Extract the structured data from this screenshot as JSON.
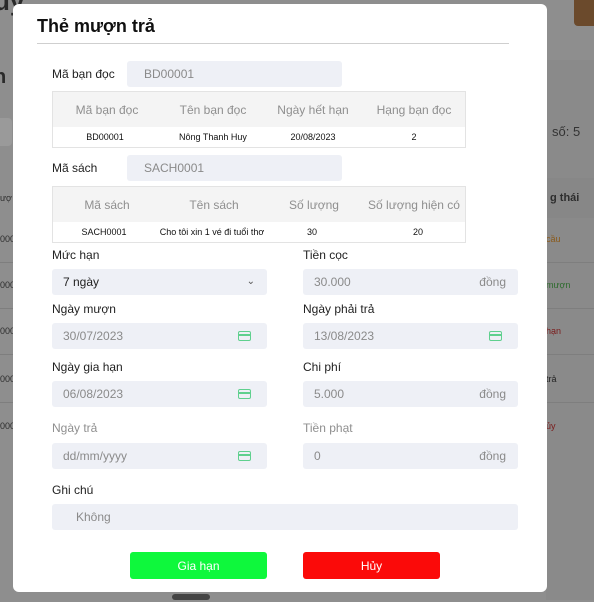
{
  "background": {
    "title_fragment": "uy",
    "letter_fragment": "n",
    "count_text": "số: 5",
    "status_header": "g thái",
    "statuses": [
      {
        "text": "cầu",
        "color": "#8a5a1a"
      },
      {
        "text": "mượn",
        "color": "#2e6b2e"
      },
      {
        "text": "hạn",
        "color": "#7a1a1a"
      },
      {
        "text": "trả",
        "color": "#222222"
      },
      {
        "text": "ủy",
        "color": "#7a1a1a"
      }
    ],
    "left_cells": [
      "000",
      "000",
      "000",
      "000",
      "000"
    ],
    "left_header": "ượ"
  },
  "modal": {
    "title": "Thẻ mượn trả",
    "reader": {
      "label": "Mã bạn đọc",
      "value": "BD00001",
      "table": {
        "headers": [
          "Mã bạn đọc",
          "Tên bạn đọc",
          "Ngày hết hạn",
          "Hạng bạn đọc"
        ],
        "row": [
          "BD00001",
          "Nông Thanh Huy",
          "20/08/2023",
          "2"
        ]
      }
    },
    "book": {
      "label": "Mã sách",
      "value": "SACH0001",
      "table": {
        "headers": [
          "Mã sách",
          "Tên sách",
          "Số lượng",
          "Số lượng hiện có"
        ],
        "row": [
          "SACH0001",
          "Cho tôi xin 1 vé đi tuổi thơ",
          "30",
          "20"
        ]
      }
    },
    "form": {
      "muc_han": {
        "label": "Mức hạn",
        "value": "7 ngày"
      },
      "tien_coc": {
        "label": "Tiền cọc",
        "value": "30.000",
        "suffix": "đồng"
      },
      "ngay_muon": {
        "label": "Ngày mượn",
        "value": "30/07/2023"
      },
      "ngay_phai_tra": {
        "label": "Ngày phải trả",
        "value": "13/08/2023"
      },
      "ngay_gia_han": {
        "label": "Ngày gia hạn",
        "value": "06/08/2023"
      },
      "chi_phi": {
        "label": "Chi phí",
        "value": "5.000",
        "suffix": "đồng"
      },
      "ngay_tra": {
        "label": "Ngày trả",
        "placeholder": "dd/mm/yyyy"
      },
      "tien_phat": {
        "label": "Tiền phạt",
        "value": "0",
        "suffix": "đồng"
      },
      "ghi_chu": {
        "label": "Ghi chú",
        "value": "Không"
      }
    },
    "buttons": {
      "extend": "Gia hạn",
      "cancel": "Hủy"
    }
  },
  "colors": {
    "extend_button": "#0ef83c",
    "cancel_button": "#fb0a09",
    "calendar_icon": "#5fd08e"
  }
}
